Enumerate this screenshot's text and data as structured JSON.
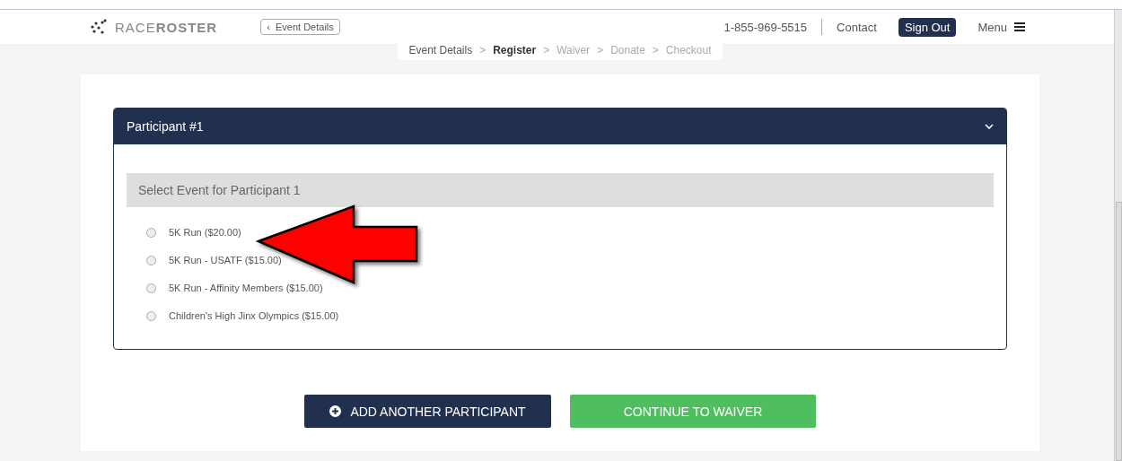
{
  "header": {
    "logo": {
      "light": "RACE",
      "bold": "ROSTER"
    },
    "back_icon": "‹",
    "back_link": "Event Details",
    "phone": "1-855-969-5515",
    "contact": "Contact",
    "sign_out": "Sign Out",
    "menu": "Menu"
  },
  "breadcrumb": [
    {
      "label": "Event Details",
      "selected": false
    },
    {
      "label": "Register",
      "selected": true
    },
    {
      "label": "Waiver",
      "selected": false
    },
    {
      "label": "Donate",
      "selected": false
    },
    {
      "label": "Checkout",
      "selected": false
    }
  ],
  "breadcrumb_separator": ">",
  "panel": {
    "title": "Participant #1",
    "expanded": true,
    "section_title": "Select Event for Participant 1",
    "options": [
      {
        "label": "5K Run ($20.00)",
        "selected": false
      },
      {
        "label": "5K Run - USATF ($15.00)",
        "selected": false
      },
      {
        "label": "5K Run - Affinity Members ($15.00)",
        "selected": false
      },
      {
        "label": "Children's High Jinx Olympics ($15.00)",
        "selected": false
      }
    ]
  },
  "buttons": [
    {
      "kind": "add",
      "label": "ADD ANOTHER PARTICIPANT"
    },
    {
      "kind": "continue",
      "label": "CONTINUE TO WAIVER"
    }
  ]
}
